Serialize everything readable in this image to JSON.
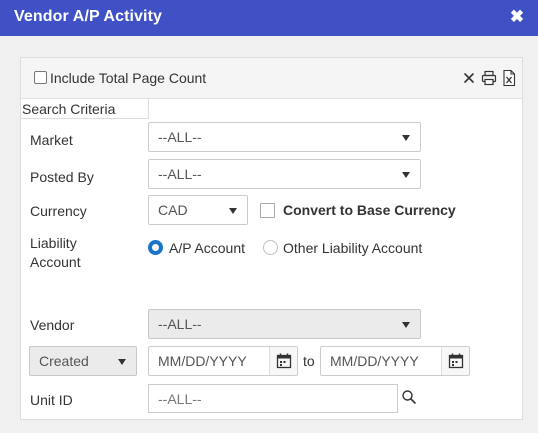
{
  "window": {
    "title": "Vendor A/P Activity",
    "close_glyph": "✖"
  },
  "header": {
    "include_total_label": "Include Total Page Count",
    "include_total_checked": false,
    "icons": [
      "close-icon",
      "print-icon",
      "excel-export-icon"
    ]
  },
  "search": {
    "label": "Search Criteria",
    "market": {
      "label": "Market",
      "value": "--ALL--"
    },
    "posted_by": {
      "label": "Posted By",
      "value": "--ALL--"
    },
    "currency": {
      "label": "Currency",
      "value": "CAD",
      "convert_label": "Convert to Base Currency",
      "convert_checked": false
    },
    "liability": {
      "label_line1": "Liability",
      "label_line2": "Account",
      "option_ap": "A/P Account",
      "option_other": "Other Liability Account",
      "selected": "A/P Account"
    },
    "vendor": {
      "label": "Vendor",
      "value": "--ALL--"
    },
    "date": {
      "type_value": "Created",
      "from_placeholder": "MM/DD/YYYY",
      "to_label": "to",
      "to_placeholder": "MM/DD/YYYY"
    },
    "unit": {
      "label": "Unit ID",
      "placeholder": "--ALL--"
    }
  },
  "colors": {
    "title_bar": "#3f51c5",
    "radio_selected": "#1a73c9"
  }
}
